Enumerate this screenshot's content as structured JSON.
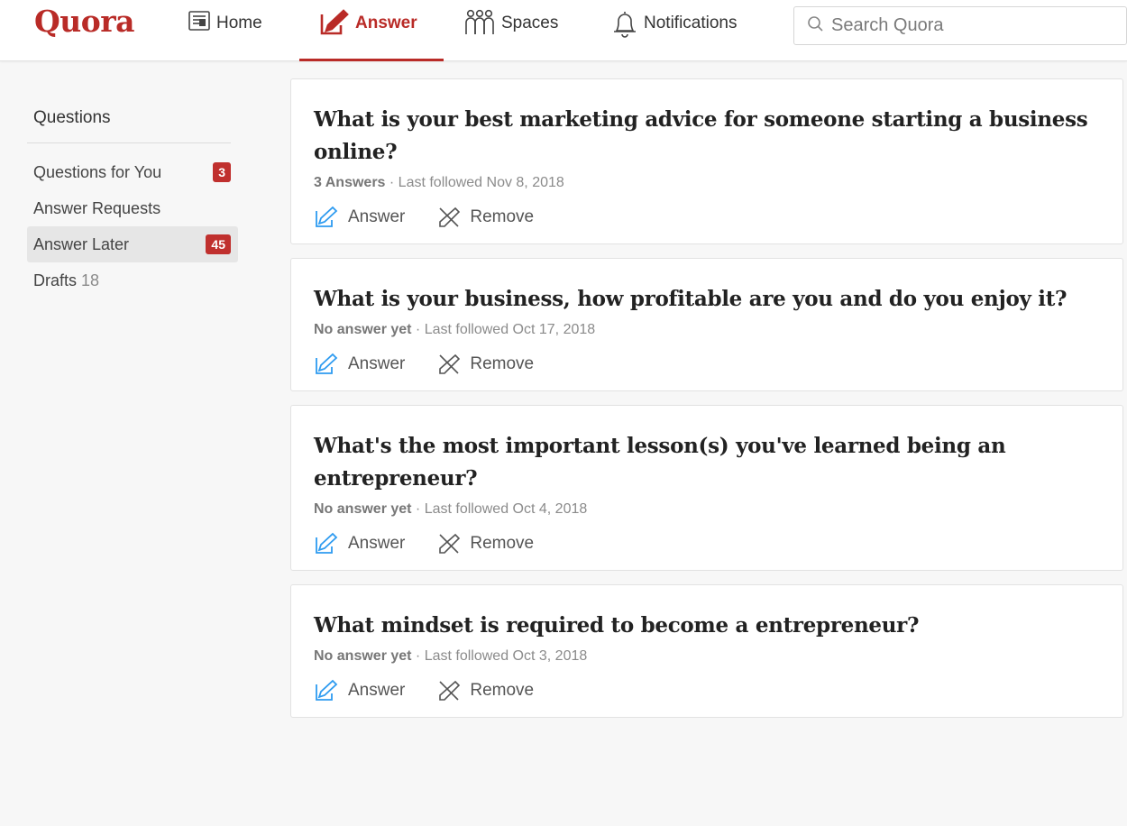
{
  "header": {
    "logo": "Quora",
    "nav": [
      {
        "label": "Home",
        "icon": "news-feed-icon"
      },
      {
        "label": "Answer",
        "icon": "pencil-icon",
        "active": true
      },
      {
        "label": "Spaces",
        "icon": "people-group-icon"
      },
      {
        "label": "Notifications",
        "icon": "bell-icon"
      }
    ],
    "search": {
      "placeholder": "Search Quora",
      "value": ""
    }
  },
  "sidebar": {
    "title": "Questions",
    "items": [
      {
        "label": "Questions for You",
        "badge": "3"
      },
      {
        "label": "Answer Requests"
      },
      {
        "label": "Answer Later",
        "badge": "45",
        "active": true
      },
      {
        "label": "Drafts",
        "count": "18"
      }
    ]
  },
  "questions": [
    {
      "title": "What is your best marketing advice for someone starting a business online?",
      "answers": "3 Answers",
      "followed": " · Last followed Nov 8, 2018",
      "answer_label": "Answer",
      "remove_label": "Remove"
    },
    {
      "title": "What is your business, how profitable are you and do you enjoy it?",
      "answers": "No answer yet",
      "followed": " · Last followed Oct 17, 2018",
      "answer_label": "Answer",
      "remove_label": "Remove"
    },
    {
      "title": "What's the most important lesson(s) you've learned being an entrepreneur?",
      "answers": "No answer yet",
      "followed": " · Last followed Oct 4, 2018",
      "answer_label": "Answer",
      "remove_label": "Remove"
    },
    {
      "title": "What mindset is required to become a entrepreneur?",
      "answers": "No answer yet",
      "followed": " · Last followed Oct 3, 2018",
      "answer_label": "Answer",
      "remove_label": "Remove"
    }
  ],
  "colors": {
    "brand": "#b92b27",
    "badge": "#c0302e",
    "answer_icon": "#2e9bf0"
  }
}
